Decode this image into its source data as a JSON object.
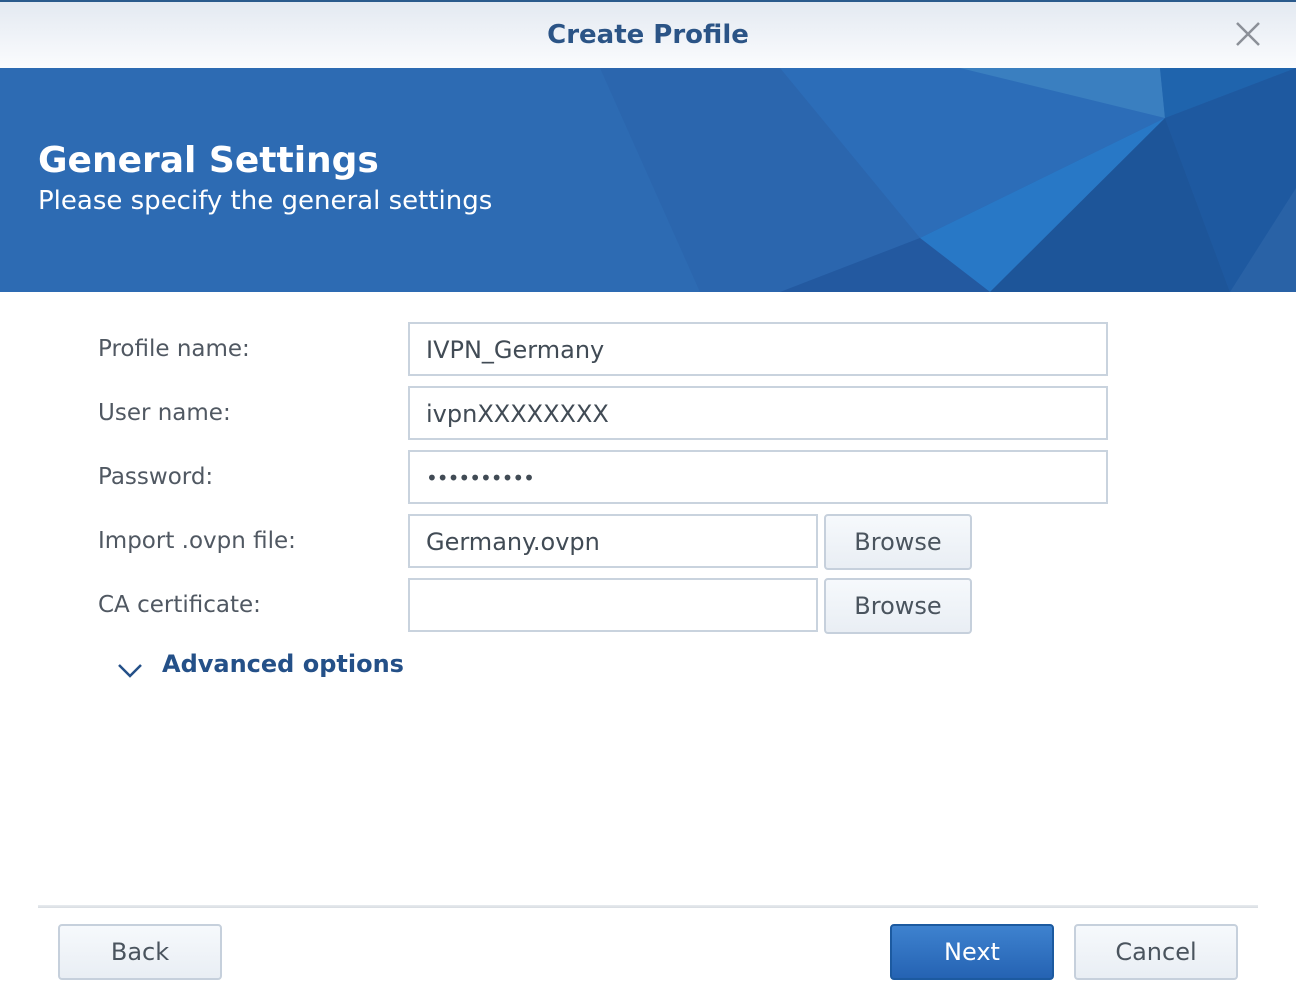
{
  "dialog": {
    "title": "Create Profile",
    "close_icon": "close-icon"
  },
  "banner": {
    "title": "General Settings",
    "subtitle": "Please specify the general settings",
    "color": "#2d6bb3"
  },
  "form": {
    "profile_name": {
      "label": "Profile name:",
      "value": "IVPN_Germany"
    },
    "user_name": {
      "label": "User name:",
      "value": "ivpnXXXXXXXX"
    },
    "password": {
      "label": "Password:",
      "value": "••••••••••"
    },
    "ovpn_file": {
      "label": "Import .ovpn file:",
      "value": "Germany.ovpn",
      "browse_label": "Browse"
    },
    "ca_certificate": {
      "label": "CA certificate:",
      "value": "",
      "browse_label": "Browse"
    },
    "advanced_options": {
      "label": "Advanced options",
      "icon": "chevron-down-icon"
    }
  },
  "footer": {
    "back_label": "Back",
    "next_label": "Next",
    "cancel_label": "Cancel",
    "primary_color": "#2a68b6"
  }
}
